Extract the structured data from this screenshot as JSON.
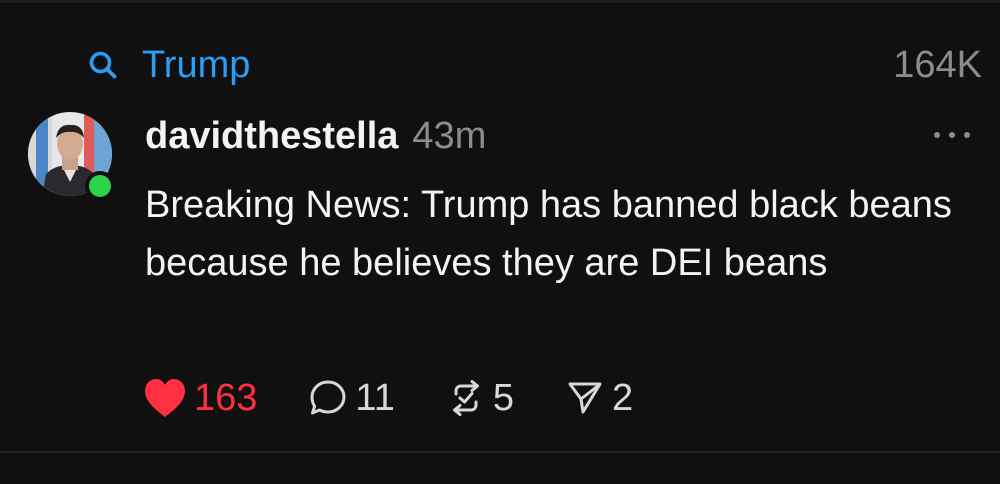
{
  "topic": {
    "icon": "search-icon",
    "label": "Trump",
    "count": "164K"
  },
  "post": {
    "username": "davidthestella",
    "time": "43m",
    "text": "Breaking News: Trump has banned black beans because he believes they are DEI beans",
    "online": true
  },
  "actions": {
    "likes": "163",
    "liked": true,
    "replies": "11",
    "reposts": "5",
    "shares": "2"
  },
  "colors": {
    "background": "#101010",
    "topic": "#2a9df4",
    "like": "#ff3040",
    "online": "#2bd24a",
    "muted": "#8c8c8c"
  }
}
